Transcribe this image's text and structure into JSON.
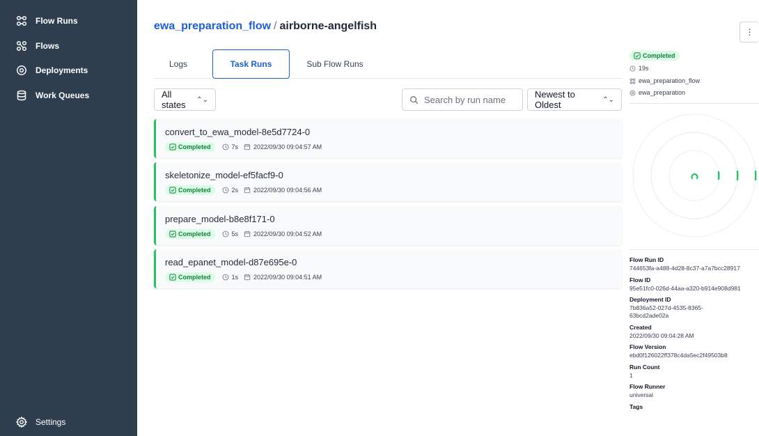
{
  "sidebar": {
    "items": [
      {
        "label": "Flow Runs",
        "icon": "flow-runs-icon"
      },
      {
        "label": "Flows",
        "icon": "flows-icon"
      },
      {
        "label": "Deployments",
        "icon": "deployments-icon"
      },
      {
        "label": "Work Queues",
        "icon": "work-queues-icon"
      }
    ],
    "settings_label": "Settings"
  },
  "header": {
    "flow_name": "ewa_preparation_flow",
    "separator": "/",
    "run_name": "airborne-angelfish"
  },
  "tabs": [
    {
      "label": "Logs",
      "active": false
    },
    {
      "label": "Task Runs",
      "active": true
    },
    {
      "label": "Sub Flow Runs",
      "active": false
    }
  ],
  "filters": {
    "state_value": "All states",
    "search_placeholder": "Search by run name",
    "sort_value": "Newest to Oldest"
  },
  "task_runs": [
    {
      "name": "convert_to_ewa_model-8e5d7724-0",
      "status": "Completed",
      "duration": "7s",
      "date": "2022/09/30 09:04:57 AM"
    },
    {
      "name": "skeletonize_model-ef5facf9-0",
      "status": "Completed",
      "duration": "2s",
      "date": "2022/09/30 09:04:56 AM"
    },
    {
      "name": "prepare_model-b8e8f171-0",
      "status": "Completed",
      "duration": "5s",
      "date": "2022/09/30 09:04:52 AM"
    },
    {
      "name": "read_epanet_model-d87e695e-0",
      "status": "Completed",
      "duration": "1s",
      "date": "2022/09/30 09:04:51 AM"
    }
  ],
  "run_panel": {
    "kebab": "⋮",
    "status": "Completed",
    "duration": "19s",
    "flow": "ewa_preparation_flow",
    "deployment": "ewa_preparation",
    "details": [
      {
        "label": "Flow Run ID",
        "value": "744653fa-a488-4d28-8c37-a7a7bcc28917"
      },
      {
        "label": "Flow ID",
        "value": "95e51fc0-026d-44aa-a320-b914e908d981"
      },
      {
        "label": "Deployment ID",
        "value": "7b836a52-027d-4535-8365-63bcd2ade02a"
      },
      {
        "label": "Created",
        "value": "2022/09/30 09:04:28 AM"
      },
      {
        "label": "Flow Version",
        "value": "ebd0f126022ff378c4da5ec2f49503b8"
      },
      {
        "label": "Run Count",
        "value": "1"
      },
      {
        "label": "Flow Runner",
        "value": "universal"
      },
      {
        "label": "Tags",
        "value": ""
      }
    ]
  },
  "colors": {
    "sidebar_bg": "#2f3e4f",
    "accent": "#1d5fd6",
    "completed": "#22c55e",
    "completed_bg": "#dcfce7"
  }
}
